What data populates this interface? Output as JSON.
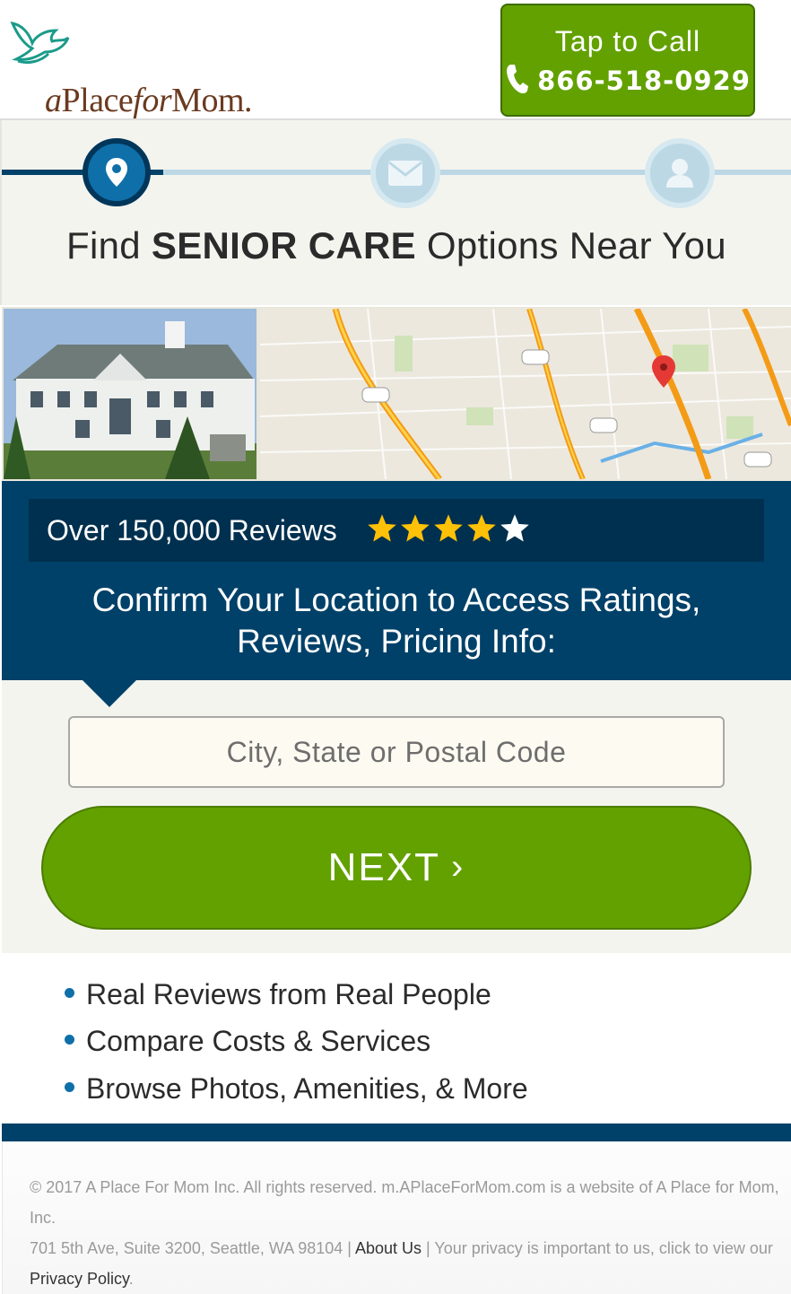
{
  "header": {
    "logo_text_prefix": "a",
    "logo_text_place": "Place",
    "logo_text_for": "for",
    "logo_text_mom": "Mom.",
    "call_label": "Tap to Call",
    "call_number": "866-518-0929"
  },
  "steps": {
    "icons": [
      "location-pin-icon",
      "envelope-icon",
      "user-icon"
    ],
    "active_color": "#0f6fa9",
    "inactive_color": "#bcd8e5"
  },
  "headline": {
    "prefix": "Find ",
    "bold": "SENIOR CARE",
    "suffix": " Options Near You"
  },
  "reviews": {
    "text": "Over 150,000 Reviews",
    "rating": 4,
    "max_rating": 5
  },
  "confirm": {
    "line1": "Confirm Your Location to Access Ratings,",
    "line2": "Reviews, Pricing Info:"
  },
  "form": {
    "location_placeholder": "City, State or Postal Code",
    "location_value": "",
    "next_label": "NEXT"
  },
  "benefits": [
    "Real Reviews from Real People",
    "Compare Costs & Services",
    "Browse Photos, Amenities, & More"
  ],
  "footer": {
    "copyright": "© 2017 A Place For Mom Inc. All rights reserved. m.APlaceForMom.com is a website of A Place for Mom, Inc.",
    "address": "701 5th Ave, Suite 3200, Seattle, WA 98104 ",
    "about_link": "About Us",
    "privacy_text": " Your privacy is important to us, click to view our",
    "privacy_link": "Privacy Policy",
    "period": "."
  },
  "colors": {
    "brand_green": "#62a100",
    "brand_navy": "#004169",
    "star_gold": "#ffc107"
  }
}
